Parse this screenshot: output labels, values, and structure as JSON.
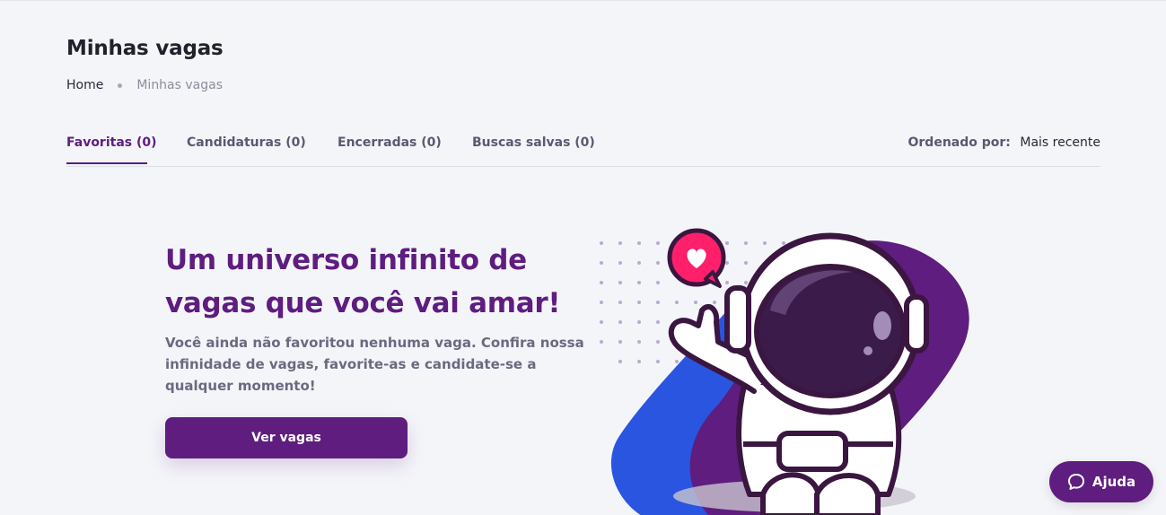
{
  "header": {
    "title": "Minhas vagas",
    "breadcrumb": {
      "home": "Home",
      "current": "Minhas vagas"
    }
  },
  "tabs": [
    {
      "label": "Favoritas (0)",
      "active": true
    },
    {
      "label": "Candidaturas (0)",
      "active": false
    },
    {
      "label": "Encerradas (0)",
      "active": false
    },
    {
      "label": "Buscas salvas (0)",
      "active": false
    }
  ],
  "sort": {
    "label": "Ordenado por:",
    "value": "Mais recente"
  },
  "empty_state": {
    "title": "Um universo infinito de vagas que você vai amar!",
    "description": "Você ainda não favoritou nenhuma vaga. Confira nossa infinidade de vagas, favorite-as e candidate-se a qualquer momento!",
    "button_label": "Ver vagas",
    "illustration_icon": "astronaut-heart-icon"
  },
  "help_button": {
    "label": "Ajuda",
    "icon": "chat-bubble-icon"
  },
  "colors": {
    "brand_purple": "#5e1d7f",
    "accent_blue": "#2a55e0",
    "heart_pink": "#ff1f6b",
    "background": "#f4f5f9"
  }
}
